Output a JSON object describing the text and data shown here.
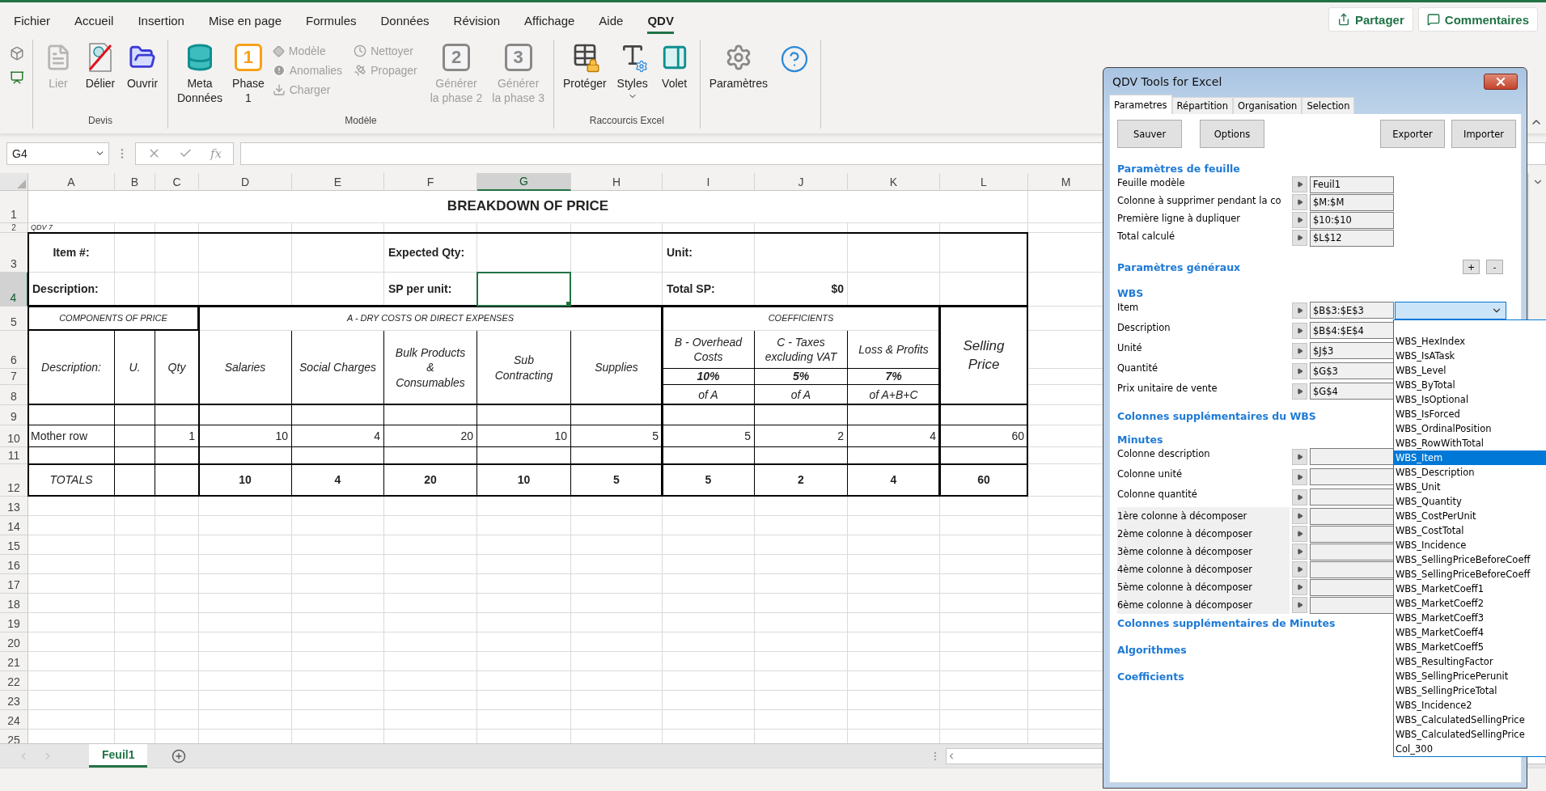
{
  "menu_tabs": [
    {
      "label": "Fichier",
      "selected": false
    },
    {
      "label": "Accueil",
      "selected": false
    },
    {
      "label": "Insertion",
      "selected": false
    },
    {
      "label": "Mise en page",
      "selected": false
    },
    {
      "label": "Formules",
      "selected": false
    },
    {
      "label": "Données",
      "selected": false
    },
    {
      "label": "Révision",
      "selected": false
    },
    {
      "label": "Affichage",
      "selected": false
    },
    {
      "label": "Aide",
      "selected": false
    },
    {
      "label": "QDV",
      "selected": true
    }
  ],
  "header_buttons": [
    {
      "kind": "share",
      "label": "Partager"
    },
    {
      "kind": "comment",
      "label": "Commentaires"
    }
  ],
  "ribbon": {
    "groups": [
      {
        "label": "Devis",
        "items": [
          {
            "kind": "large",
            "label": "Lier",
            "disabled": true,
            "menu": false
          },
          {
            "kind": "large",
            "label": "Délier",
            "disabled": false,
            "menu": false
          },
          {
            "kind": "large",
            "label": "Ouvrir",
            "disabled": false,
            "menu": false
          }
        ]
      },
      {
        "label": "Modèle",
        "items": [
          {
            "kind": "large",
            "label": "Meta\nDonnées",
            "disabled": false,
            "menu": false
          },
          {
            "kind": "badge",
            "badge": "1",
            "label": "Phase\n1",
            "disabled": false
          },
          {
            "kind": "stack",
            "entries": [
              {
                "label": "Modèle",
                "disabled": true
              },
              {
                "label": "Anomalies",
                "disabled": true
              },
              {
                "label": "Charger",
                "disabled": true
              }
            ]
          },
          {
            "kind": "stack",
            "entries": [
              {
                "label": "Nettoyer",
                "disabled": true
              },
              {
                "label": "Propager",
                "disabled": true
              }
            ]
          },
          {
            "kind": "badge",
            "badge": "2",
            "label": "Générer\nla phase 2",
            "disabled": true
          },
          {
            "kind": "badge",
            "badge": "3",
            "label": "Générer\nla phase 3",
            "disabled": true
          }
        ]
      },
      {
        "label": "Raccourcis Excel",
        "items": [
          {
            "kind": "large",
            "label": "Protéger",
            "disabled": false,
            "menu": false
          },
          {
            "kind": "large",
            "label": "Styles",
            "disabled": false,
            "menu": true
          },
          {
            "kind": "large",
            "label": "Volet",
            "disabled": false,
            "menu": false
          }
        ]
      },
      {
        "items": [
          {
            "kind": "large",
            "label": "Paramètres",
            "disabled": false,
            "menu": false
          },
          {
            "kind": "icon",
            "disabled": false
          }
        ]
      }
    ]
  },
  "formula_bar": {
    "name_box": "G4",
    "function_label": "fx"
  },
  "sheet": {
    "columns": [
      {
        "label": "A",
        "selected": false
      },
      {
        "label": "B",
        "selected": false
      },
      {
        "label": "C",
        "selected": false
      },
      {
        "label": "D",
        "selected": false
      },
      {
        "label": "E",
        "selected": false
      },
      {
        "label": "F",
        "selected": false
      },
      {
        "label": "G",
        "selected": true
      },
      {
        "label": "H",
        "selected": false
      },
      {
        "label": "I",
        "selected": false
      },
      {
        "label": "J",
        "selected": false
      },
      {
        "label": "K",
        "selected": false
      },
      {
        "label": "L",
        "selected": false
      },
      {
        "label": "M",
        "selected": false
      }
    ],
    "rows": [
      {
        "label": "1",
        "selected": false
      },
      {
        "label": "2",
        "selected": false
      },
      {
        "label": "3",
        "selected": false
      },
      {
        "label": "4",
        "selected": true
      },
      {
        "label": "5",
        "selected": false
      },
      {
        "label": "6",
        "selected": false
      },
      {
        "label": "7",
        "selected": false
      },
      {
        "label": "8",
        "selected": false
      },
      {
        "label": "9",
        "selected": false
      },
      {
        "label": "10",
        "selected": false
      },
      {
        "label": "11",
        "selected": false
      },
      {
        "label": "12",
        "selected": false
      },
      {
        "label": "13",
        "selected": false
      },
      {
        "label": "14",
        "selected": false
      },
      {
        "label": "15",
        "selected": false
      },
      {
        "label": "16",
        "selected": false
      },
      {
        "label": "17",
        "selected": false
      },
      {
        "label": "18",
        "selected": false
      },
      {
        "label": "19",
        "selected": false
      },
      {
        "label": "20",
        "selected": false
      },
      {
        "label": "21",
        "selected": false
      },
      {
        "label": "22",
        "selected": false
      },
      {
        "label": "23",
        "selected": false
      },
      {
        "label": "24",
        "selected": false
      },
      {
        "label": "25",
        "selected": false
      }
    ],
    "cells": [
      {
        "kind": "title",
        "text": "BREAKDOWN OF PRICE"
      },
      {
        "kind": "note",
        "text": "QDV 7"
      },
      {
        "kind": "label_center",
        "text": "Item #:"
      },
      {
        "kind": "label",
        "text": "Expected Qty:"
      },
      {
        "kind": "label",
        "text": "Unit:"
      },
      {
        "kind": "label",
        "text": "Description:"
      },
      {
        "kind": "label",
        "text": "SP per unit:"
      },
      {
        "kind": "label",
        "text": "Total SP:"
      },
      {
        "kind": "amount",
        "text": "$0"
      },
      {
        "kind": "section",
        "text": "COMPONENTS OF PRICE"
      },
      {
        "kind": "section",
        "text": "A - DRY COSTS OR DIRECT EXPENSES"
      },
      {
        "kind": "section",
        "text": "COEFFICIENTS"
      },
      {
        "kind": "big",
        "text": "Selling\nPrice"
      },
      {
        "kind": "colhead",
        "text": "Description:"
      },
      {
        "kind": "colhead",
        "text": "U."
      },
      {
        "kind": "colhead",
        "text": "Qty"
      },
      {
        "kind": "colhead",
        "text": "Salaries"
      },
      {
        "kind": "colhead",
        "text": "Social Charges"
      },
      {
        "kind": "colhead",
        "text": "Bulk Products\n&\nConsumables"
      },
      {
        "kind": "colhead",
        "text": "Sub\nContracting"
      },
      {
        "kind": "colhead",
        "text": "Supplies"
      },
      {
        "kind": "colhead",
        "text": "B - Overhead\nCosts"
      },
      {
        "kind": "colhead",
        "text": "C - Taxes\nexcluding VAT"
      },
      {
        "kind": "colhead",
        "text": "Loss & Profits"
      },
      {
        "kind": "pct",
        "text": "10%"
      },
      {
        "kind": "pct",
        "text": "5%"
      },
      {
        "kind": "pct",
        "text": "7%"
      },
      {
        "kind": "colhead",
        "text": "of A"
      },
      {
        "kind": "colhead",
        "text": "of A"
      },
      {
        "kind": "colhead",
        "text": "of A+B+C"
      },
      {
        "kind": "text",
        "text": "Mother row"
      },
      {
        "kind": "number",
        "text": "1"
      },
      {
        "kind": "number",
        "text": "10"
      },
      {
        "kind": "number",
        "text": "4"
      },
      {
        "kind": "number",
        "text": "20"
      },
      {
        "kind": "number",
        "text": "10"
      },
      {
        "kind": "number",
        "text": "5"
      },
      {
        "kind": "number",
        "text": "5"
      },
      {
        "kind": "number",
        "text": "2"
      },
      {
        "kind": "number",
        "text": "4"
      },
      {
        "kind": "number",
        "text": "60"
      },
      {
        "kind": "total_label",
        "text": "TOTALS"
      },
      {
        "kind": "total",
        "text": "10"
      },
      {
        "kind": "total",
        "text": "4"
      },
      {
        "kind": "total",
        "text": "20"
      },
      {
        "kind": "total",
        "text": "10"
      },
      {
        "kind": "total",
        "text": "5"
      },
      {
        "kind": "total",
        "text": "5"
      },
      {
        "kind": "total",
        "text": "2"
      },
      {
        "kind": "total",
        "text": "4"
      },
      {
        "kind": "total",
        "text": "60"
      }
    ]
  },
  "sheet_tabs": [
    {
      "label": "Feuil1",
      "selected": true
    }
  ],
  "dialog": {
    "title": "QDV Tools for Excel",
    "tabs": [
      {
        "label": "Parametres",
        "selected": true
      },
      {
        "label": "Répartition",
        "selected": false
      },
      {
        "label": "Organisation",
        "selected": false
      },
      {
        "label": "Selection",
        "selected": false
      }
    ],
    "buttons": [
      "Sauver",
      "Options",
      "Exporter",
      "Importer"
    ],
    "sections": [
      {
        "title": "Paramètres de feuille",
        "rows": [
          {
            "label": "Feuille modèle",
            "value": "Feuil1",
            "shaded": false
          },
          {
            "label": "Colonne à supprimer pendant la co",
            "value": "$M:$M",
            "shaded": false
          },
          {
            "label": "Première ligne à dupliquer",
            "value": "$10:$10",
            "shaded": false
          },
          {
            "label": "Total calculé",
            "value": "$L$12",
            "shaded": false
          }
        ]
      },
      {
        "title": "Paramètres généraux",
        "controls": [
          "+",
          "-"
        ]
      },
      {
        "title": "WBS",
        "rows": [
          {
            "label": "Item",
            "value": "$B$3:$E$3",
            "shaded": false,
            "combo": {
              "expanded": true,
              "options": [
                {
                  "label": "WBS_HexIndex",
                  "selected": false
                },
                {
                  "label": "WBS_IsATask",
                  "selected": false
                },
                {
                  "label": "WBS_Level",
                  "selected": false
                },
                {
                  "label": "WBS_ByTotal",
                  "selected": false
                },
                {
                  "label": "WBS_IsOptional",
                  "selected": false
                },
                {
                  "label": "WBS_IsForced",
                  "selected": false
                },
                {
                  "label": "WBS_OrdinalPosition",
                  "selected": false
                },
                {
                  "label": "WBS_RowWithTotal",
                  "selected": false
                },
                {
                  "label": "WBS_Item",
                  "selected": true
                },
                {
                  "label": "WBS_Description",
                  "selected": false
                },
                {
                  "label": "WBS_Unit",
                  "selected": false
                },
                {
                  "label": "WBS_Quantity",
                  "selected": false
                },
                {
                  "label": "WBS_CostPerUnit",
                  "selected": false
                },
                {
                  "label": "WBS_CostTotal",
                  "selected": false
                },
                {
                  "label": "WBS_Incidence",
                  "selected": false
                },
                {
                  "label": "WBS_SellingPriceBeforeCoeff",
                  "selected": false
                },
                {
                  "label": "WBS_SellingPriceBeforeCoeff",
                  "selected": false
                },
                {
                  "label": "WBS_MarketCoeff1",
                  "selected": false
                },
                {
                  "label": "WBS_MarketCoeff2",
                  "selected": false
                },
                {
                  "label": "WBS_MarketCoeff3",
                  "selected": false
                },
                {
                  "label": "WBS_MarketCoeff4",
                  "selected": false
                },
                {
                  "label": "WBS_MarketCoeff5",
                  "selected": false
                },
                {
                  "label": "WBS_ResultingFactor",
                  "selected": false
                },
                {
                  "label": "WBS_SellingPricePerunit",
                  "selected": false
                },
                {
                  "label": "WBS_SellingPriceTotal",
                  "selected": false
                },
                {
                  "label": "WBS_Incidence2",
                  "selected": false
                },
                {
                  "label": "WBS_CalculatedSellingPrice",
                  "selected": false
                },
                {
                  "label": "WBS_CalculatedSellingPrice",
                  "selected": false
                },
                {
                  "label": "Col_300",
                  "selected": false
                }
              ]
            }
          },
          {
            "label": "Description",
            "value": "$B$4:$E$4",
            "shaded": false
          },
          {
            "label": "Unité",
            "value": "$J$3",
            "shaded": false
          },
          {
            "label": "Quantité",
            "value": "$G$3",
            "shaded": false
          },
          {
            "label": "Prix unitaire de vente",
            "value": "$G$4",
            "shaded": false
          }
        ]
      },
      {
        "title": "Colonnes supplémentaires du WBS"
      },
      {
        "title": "Minutes",
        "rows": [
          {
            "label": "Colonne description",
            "shaded": false
          },
          {
            "label": "Colonne unité",
            "shaded": false
          },
          {
            "label": "Colonne quantité",
            "shaded": false
          },
          {
            "label": "1ère colonne à décomposer",
            "shaded": true
          },
          {
            "label": "2ème colonne à décomposer",
            "shaded": true
          },
          {
            "label": "3ème colonne à décomposer",
            "shaded": true
          },
          {
            "label": "4ème colonne à décomposer",
            "shaded": true
          },
          {
            "label": "5ème colonne à décomposer",
            "shaded": true
          },
          {
            "label": "6ème colonne à décomposer",
            "shaded": true
          }
        ]
      },
      {
        "title": "Colonnes supplémentaires de Minutes"
      },
      {
        "title": "Algorithmes"
      },
      {
        "title": "Coefficients"
      }
    ]
  }
}
